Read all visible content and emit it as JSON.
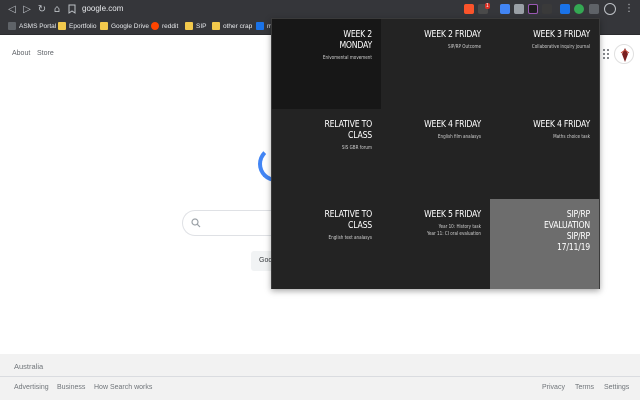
{
  "browser": {
    "url": "google.com",
    "bookmarks": [
      {
        "label": "ASMS Portal",
        "color": "#5f6368"
      },
      {
        "label": "Eportfolio",
        "color": "#f2c94c"
      },
      {
        "label": "Google Drive",
        "color": "#f2c94c"
      },
      {
        "label": "reddit",
        "color": "#ff4500"
      },
      {
        "label": "SIP",
        "color": "#f2c94c"
      },
      {
        "label": "other crap",
        "color": "#f2c94c"
      },
      {
        "label": "m",
        "color": "#1a73e8"
      }
    ],
    "extension_badge": "1"
  },
  "google": {
    "top_links": [
      "About",
      "Store"
    ],
    "search_button_label": "Goo",
    "footer": {
      "country": "Australia",
      "left_links": [
        "Advertising",
        "Business",
        "How Search works"
      ],
      "right_links": [
        "Privacy",
        "Terms",
        "Settings"
      ]
    }
  },
  "popup": {
    "tiles": [
      {
        "title": "WEEK 2\nMONDAY",
        "subtitle": "Enivomental movement"
      },
      {
        "title": "WEEK 2 FRIDAY",
        "subtitle": "SIP/RP Outcome"
      },
      {
        "title": "WEEK 3 FRIDAY",
        "subtitle": "Collaborative inquiry journal"
      },
      {
        "title": "RELATIVE TO\nCLASS",
        "subtitle": "SIS GBR forum"
      },
      {
        "title": "WEEK 4 FRIDAY",
        "subtitle": "English film analasys"
      },
      {
        "title": "WEEK 4 FRIDAY",
        "subtitle": "Maths choice task"
      },
      {
        "title": "RELATIVE TO\nCLASS",
        "subtitle": "English text analasys"
      },
      {
        "title": "WEEK 5 FRIDAY",
        "subtitle": "Year 10: History task\nYear 11: CI oral evaluation"
      },
      {
        "title": "SIP/RP\nEVALUATION\nSIP/RP\n17/11/19",
        "subtitle": ""
      }
    ],
    "highlight_color": "#6d6d6d"
  }
}
